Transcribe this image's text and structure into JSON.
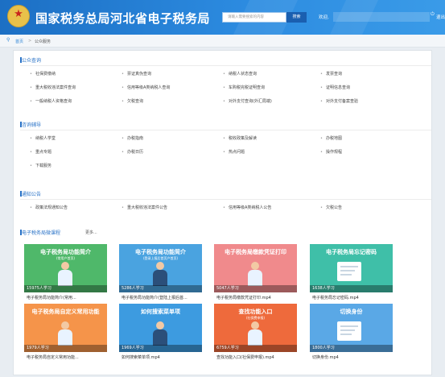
{
  "header": {
    "emblem_icon": "national-emblem-icon",
    "site_title": "国家税务总局河北省电子税务局",
    "search_placeholder": "请输入需要搜索的内容",
    "search_button": "搜索",
    "welcome": "欢迎,",
    "logout": "退出",
    "logout_icon": "logout-icon"
  },
  "breadcrumb": {
    "home": "首页",
    "separator": ">",
    "current": "公众服务"
  },
  "sections": [
    {
      "title": "公众查询",
      "items": [
        "社保费缴纳",
        "票证真伪查询",
        "纳税人状态查询",
        "发票查询",
        "重大税收违法案件查询",
        "信用等级A类纳税人查询",
        "车购税完税证明查询",
        "证明信息查询",
        "一般纳税人资格查询",
        "欠税查询",
        "对外支付查询(外汇局端)",
        "对外支付备案查验"
      ]
    },
    {
      "title": "咨询辅导",
      "items": [
        "纳税人学堂",
        "办税指南",
        "税收政策及解读",
        "办税地图",
        "重点专题",
        "办税日历",
        "热点问题",
        "操作规程",
        "下载服务"
      ]
    },
    {
      "title": "通知公告",
      "items": [
        "政策法规通知公告",
        "重大税收违法案件公告",
        "信用等级A类纳税人公告",
        "欠税公告"
      ]
    }
  ],
  "videos": {
    "title": "电子税务局微课程",
    "more": "更多...",
    "cards": [
      {
        "title": "电子税务局功能简介",
        "sub": "(常用户首页)",
        "count": "15975人学习",
        "caption": "电子税务局功能简介(常用...",
        "color": "#4fb86a"
      },
      {
        "title": "电子税务局功能简介",
        "sub": "(登录上报后首页户首页)",
        "count": "5286人学习",
        "caption": "电子税务局功能简介(登陆上报后首...",
        "color": "#4aa3e0"
      },
      {
        "title": "电子税务局缴款凭证打印",
        "sub": "",
        "count": "5047人学习",
        "caption": "电子税务局缴款凭证打印.mp4",
        "color": "#f08a8c"
      },
      {
        "title": "电子税务局忘记密码",
        "sub": "",
        "count": "1638人学习",
        "caption": "电子税务局忘记密码.mp4",
        "color": "#3fbfa8"
      },
      {
        "title": "电子税务局自定义常用功能",
        "sub": "",
        "count": "1979人学习",
        "caption": "电子税务局自定义常用功能...",
        "color": "#f5944a"
      },
      {
        "title": "如何搜索菜单项",
        "sub": "",
        "count": "1969人学习",
        "caption": "如何搜索菜单项.mp4",
        "color": "#3d9be0"
      },
      {
        "title": "查找功能入口",
        "sub": "(社保费申报)",
        "count": "6759人学习",
        "caption": "查找功能入口(社保费申报).mp4",
        "color": "#ee6a3c"
      },
      {
        "title": "切换身份",
        "sub": "",
        "count": "1800人学习",
        "caption": "切换身份.mp4",
        "color": "#5aa8e6"
      }
    ]
  }
}
